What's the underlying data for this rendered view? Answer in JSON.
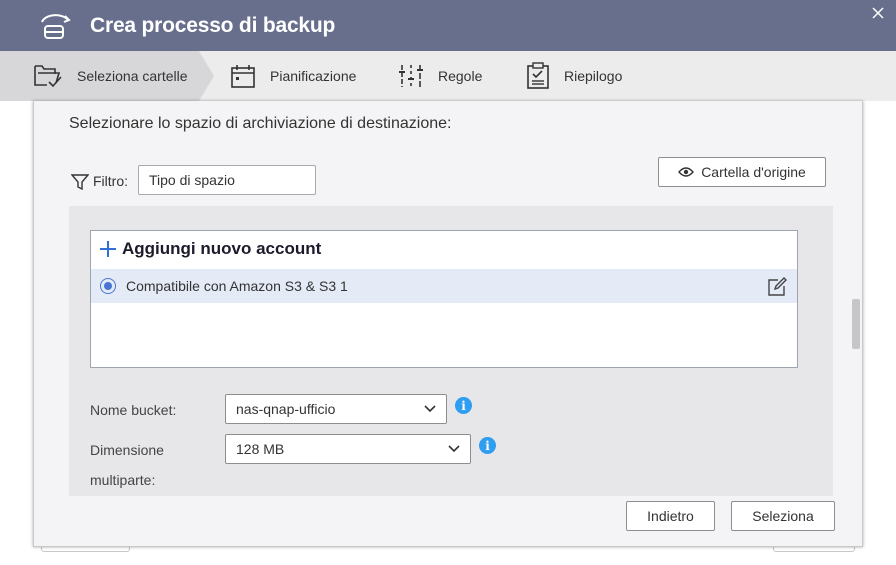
{
  "window": {
    "title": "Crea processo di backup"
  },
  "steps": [
    {
      "label": "Seleziona cartelle",
      "active": true
    },
    {
      "label": "Pianificazione"
    },
    {
      "label": "Regole"
    },
    {
      "label": "Riepilogo"
    }
  ],
  "dialog": {
    "heading": "Selezionare lo spazio di archiviazione di destinazione:",
    "filter": {
      "label": "Filtro:",
      "value": "Tipo di spazio"
    },
    "origin_button": "Cartella d'origine",
    "add_account": "Aggiungi nuovo account",
    "accounts": [
      {
        "label": "Compatibile con Amazon S3 & S3 1",
        "selected": true
      }
    ],
    "bucket": {
      "label": "Nome bucket:",
      "value": "nas-qnap-ufficio"
    },
    "multipart": {
      "label_line1": "Dimensione",
      "label_line2": "multiparte:",
      "value": "128 MB"
    },
    "back_button": "Indietro",
    "select_button": "Seleziona"
  },
  "colors": {
    "titlebar": "#686f8c",
    "accent": "#4a74d4",
    "info": "#2f9df0"
  },
  "icons": [
    "backup-app-icon",
    "close-icon",
    "folder-check-icon",
    "calendar-icon",
    "sliders-icon",
    "clipboard-icon",
    "filter-icon",
    "eye-icon",
    "plus-icon",
    "edit-icon",
    "chevron-down-icon",
    "info-icon"
  ]
}
